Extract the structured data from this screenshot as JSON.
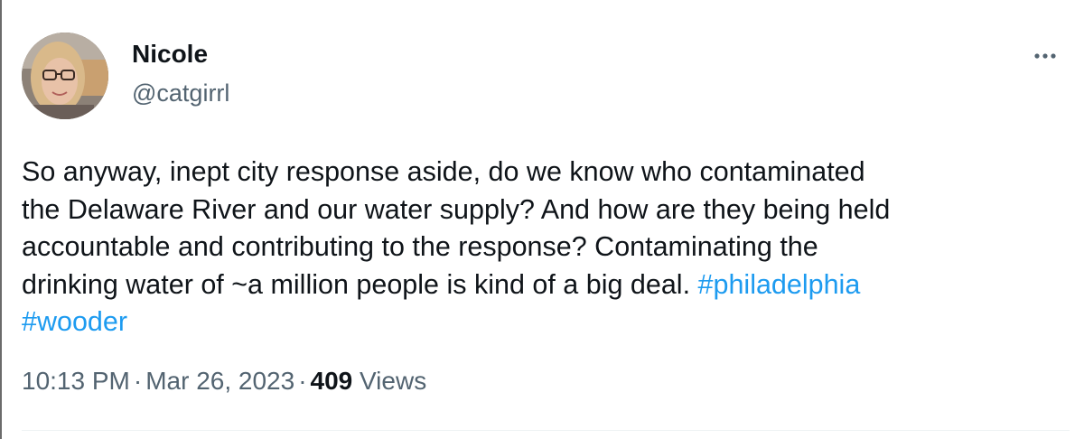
{
  "author": {
    "display_name": "Nicole",
    "handle": "@catgirrl"
  },
  "more_icon": "more-horizontal-icon",
  "tweet": {
    "lines": [
      "So anyway, inept city response aside, do we know who contaminated",
      "the Delaware River and our water supply? And how are they being held",
      "accountable and contributing to the response? Contaminating the"
    ],
    "line4_text": "drinking water of ~a million people is kind of a big deal. ",
    "hashtags": [
      "#philadelphia",
      "#wooder"
    ]
  },
  "meta": {
    "time": "10:13 PM",
    "separator": "·",
    "date": "Mar 26, 2023",
    "views_count": "409",
    "views_label": "Views"
  },
  "colors": {
    "text": "#0f1419",
    "secondary": "#536471",
    "link": "#1d9bf0"
  }
}
